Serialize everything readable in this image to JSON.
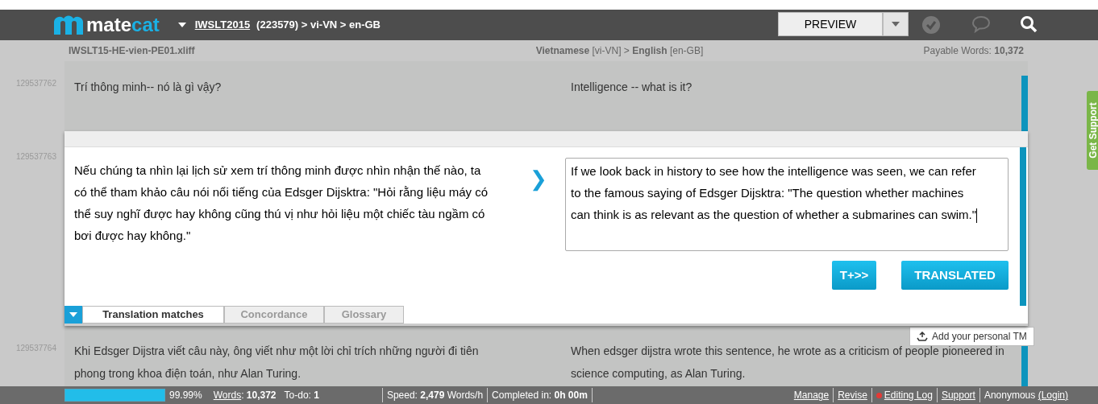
{
  "header": {
    "logo": {
      "part_1": "mate",
      "part_2": "cat"
    },
    "project_link": "IWSLT2015",
    "project_info": "(223579) > vi-VN > en-GB",
    "preview_button": "PREVIEW"
  },
  "subheader": {
    "file_name": "IWSLT15-HE-vien-PE01.xliff",
    "languages": "**Vietnamese** [vi-VN] > **English** [en-GB]",
    "payable_words": "Payable Words: **10,372**"
  },
  "segments": [
    {
      "kind": "inactive",
      "id": "129537762",
      "source": "Trí thông minh-- nó là gì vậy?",
      "target": "Intelligence -- what is it?"
    },
    {
      "kind": "active",
      "id": "129537763",
      "source": "Nếu chúng ta nhìn lại lịch sử xem trí thông minh được nhìn nhận thế nào, ta có thể tham khảo câu nói nổi tiếng của Edsger Dijsktra: \"Hỏi rằng liệu máy có thể suy nghĩ được hay không cũng thú vị như hỏi liệu một chiếc tàu ngầm có bơi được hay không.\"",
      "target": "If we look back in history to see how the intelligence was seen, we can refer to the famous saying of Edsger Dijsktra: \"The question whether machines can think is as relevant as the question of whether a submarines can swim.\"",
      "arrow": "❯",
      "buttons": [
        "T+>>",
        "TRANSLATED"
      ],
      "tabs": [
        {
          "label": "Translation matches",
          "selected": true
        },
        {
          "label": "Concordance",
          "selected": false
        },
        {
          "label": "Glossary",
          "selected": false
        }
      ]
    },
    {
      "kind": "inactive",
      "id": "129537764",
      "source": "Khi Edsger Dijstra viết câu này, ông viết như một lời chỉ trích những người đi tiên phong trong khoa điện toán, như Alan Turing.",
      "target": "When edsger dijstra wrote this sentence, he wrote as a criticism of people pioneered in science computing, as Alan Turing."
    }
  ],
  "tooltip": "Add your personal TM",
  "side_tab": "Get Support",
  "footer": {
    "progress": {
      "level": 0.9999
    },
    "percent": "99.99%",
    "words_label": "Words",
    "words_value": ": **10,372**",
    "todo": "To-do: **1**",
    "speed": "Speed: **2,479** Words/h",
    "completed": "Completed in: **0h 00m**",
    "links": [
      "Manage",
      "Revise",
      "Editing Log",
      "Support"
    ],
    "user": "Anonymous",
    "login": "(Login)"
  }
}
